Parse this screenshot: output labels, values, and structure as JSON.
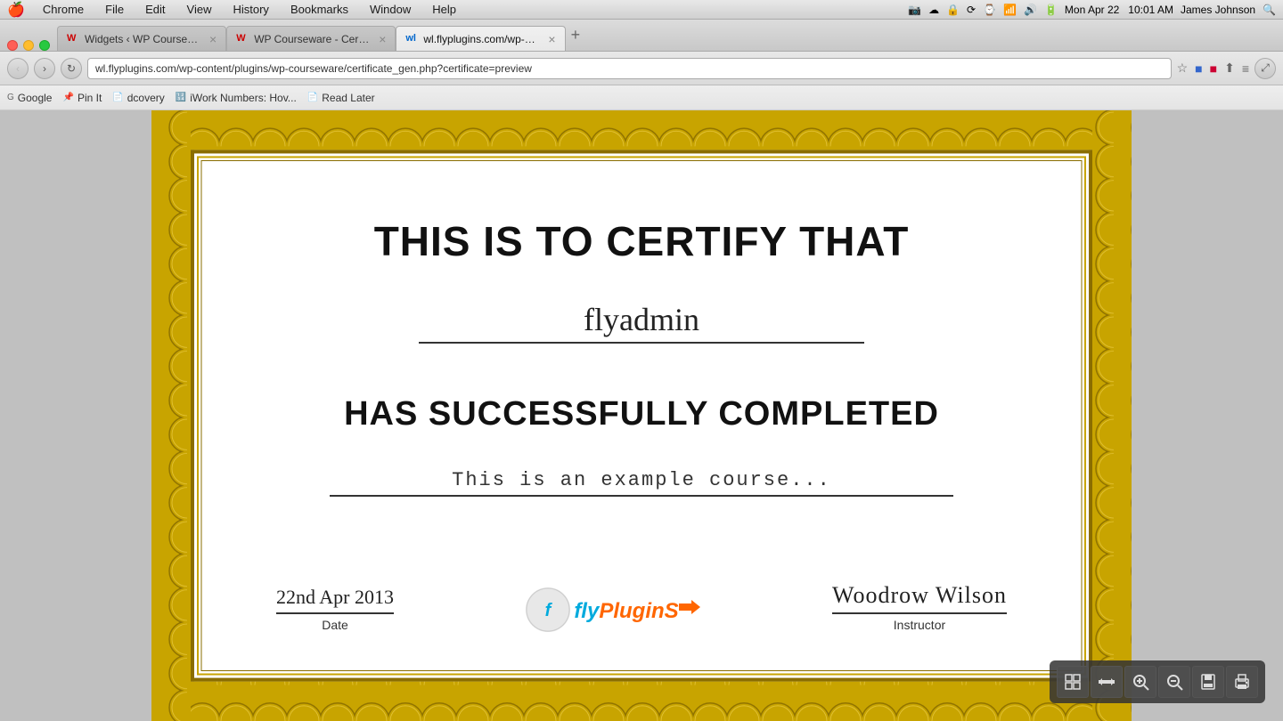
{
  "os": {
    "menu_bar": {
      "apple": "🍎",
      "items": [
        "Chrome",
        "File",
        "Edit",
        "View",
        "History",
        "Bookmarks",
        "Window",
        "Help"
      ],
      "right_items": [
        "📷",
        "☁",
        "🔒",
        "⟳",
        "⌚",
        "🔊",
        "🔋",
        "Mon Apr 22",
        "10:01 AM",
        "James Johnson",
        "🔍"
      ]
    }
  },
  "browser": {
    "tabs": [
      {
        "id": "tab1",
        "favicon": "wp",
        "title": "Widgets ‹ WP Courseware...",
        "active": false
      },
      {
        "id": "tab2",
        "favicon": "wp",
        "title": "WP Courseware - Certifica...",
        "active": false
      },
      {
        "id": "tab3",
        "favicon": "wl",
        "title": "wl.flyplugins.com/wp-con...",
        "active": true
      }
    ],
    "address": "wl.flyplugins.com/wp-content/plugins/wp-courseware/certificate_gen.php?certificate=preview",
    "bookmarks": [
      {
        "id": "google",
        "label": "Google"
      },
      {
        "id": "pinit",
        "label": "Pin It"
      },
      {
        "id": "dcovery",
        "label": "dcovery"
      },
      {
        "id": "iwork",
        "label": "iWork Numbers: Hov..."
      },
      {
        "id": "readlater",
        "label": "Read Later"
      }
    ]
  },
  "certificate": {
    "title": "THIS IS TO CERTIFY THAT",
    "student_name": "flyadmin",
    "subtitle": "HAS SUCCESSFULLY COMPLETED",
    "course_name": "This is an example course...",
    "date_value": "22nd Apr 2013",
    "date_label": "Date",
    "logo_fly": "fly",
    "logo_plugins": "PluginS",
    "instructor_signature": "Woodrow Wilson",
    "instructor_label": "Instructor"
  },
  "pdf_toolbar": {
    "tools": [
      {
        "id": "fit-page",
        "icon": "⊡",
        "label": "Fit Page"
      },
      {
        "id": "fit-width",
        "icon": "↔",
        "label": "Fit Width"
      },
      {
        "id": "zoom-in",
        "icon": "⊕",
        "label": "Zoom In"
      },
      {
        "id": "zoom-out",
        "icon": "⊖",
        "label": "Zoom Out"
      },
      {
        "id": "save",
        "icon": "💾",
        "label": "Save"
      },
      {
        "id": "print",
        "icon": "🖨",
        "label": "Print"
      }
    ]
  }
}
